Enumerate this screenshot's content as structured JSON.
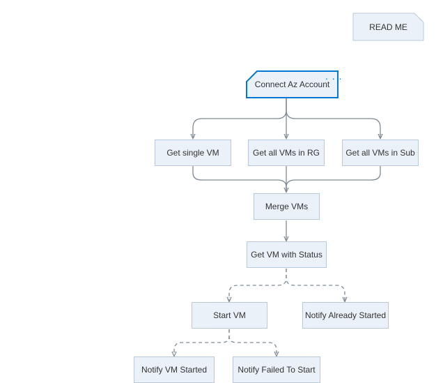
{
  "readme": {
    "label": "READ ME"
  },
  "connect": {
    "label": "Connect Az Account",
    "ellipsis": ". . ."
  },
  "get_single_vm": {
    "label": "Get single VM"
  },
  "get_vms_rg": {
    "label": "Get all VMs in RG"
  },
  "get_vms_sub": {
    "label": "Get all VMs in Sub"
  },
  "merge_vms": {
    "label": "Merge VMs"
  },
  "get_vm_status": {
    "label": "Get VM with Status"
  },
  "start_vm": {
    "label": "Start VM"
  },
  "notify_already_started": {
    "label": "Notify Already Started"
  },
  "notify_vm_started": {
    "label": "Notify VM Started"
  },
  "notify_failed": {
    "label": "Notify Failed To Start"
  },
  "colors": {
    "node_fill": "#eaf1f8",
    "node_border": "#b9c9d9",
    "accent": "#0078d4",
    "arrow": "#7f8a96"
  }
}
